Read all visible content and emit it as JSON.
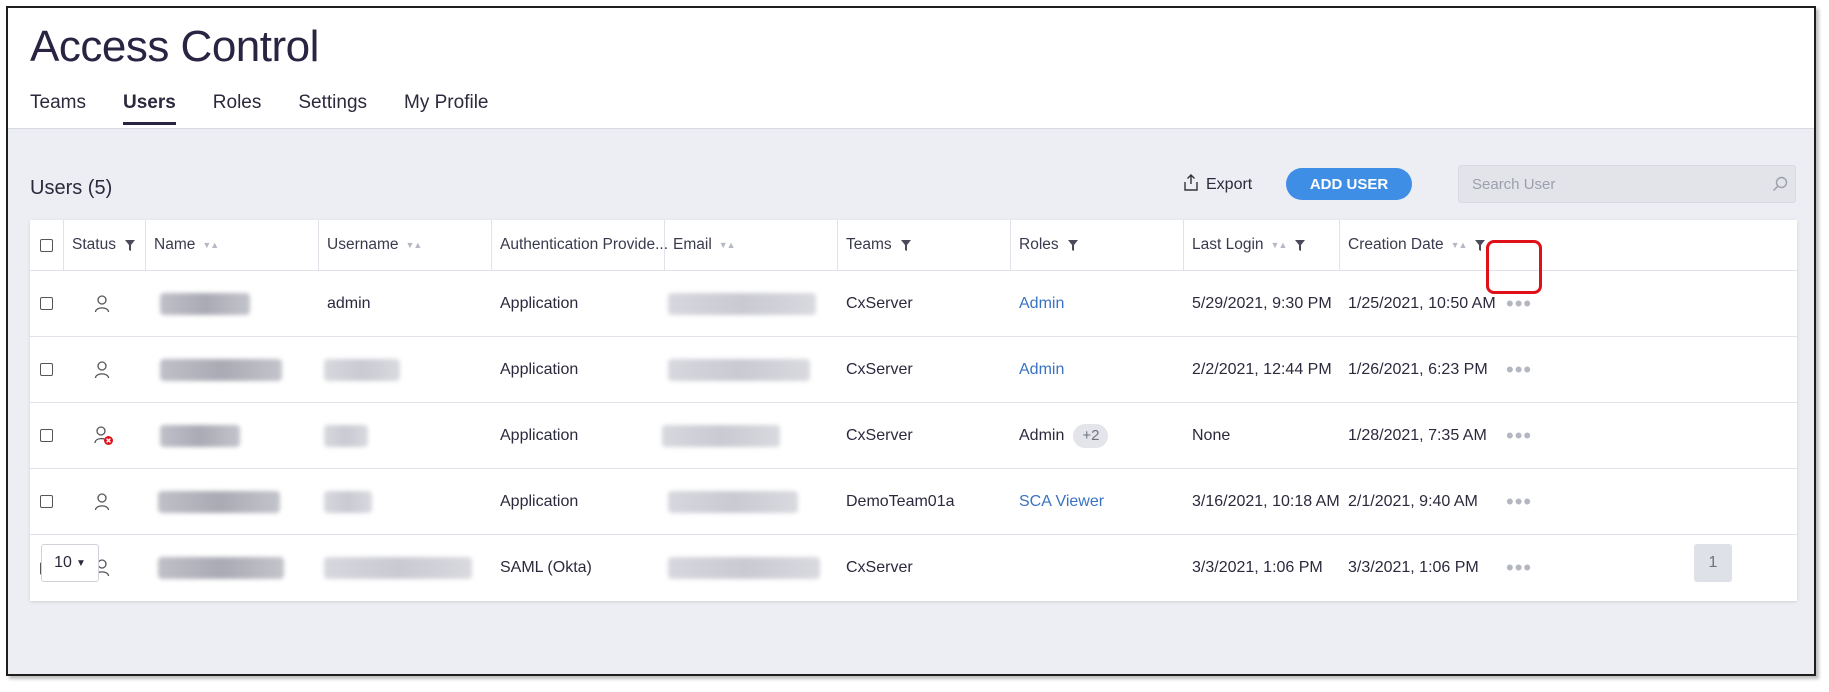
{
  "page": {
    "title": "Access Control"
  },
  "tabs": [
    {
      "label": "Teams",
      "active": false
    },
    {
      "label": "Users",
      "active": true
    },
    {
      "label": "Roles",
      "active": false
    },
    {
      "label": "Settings",
      "active": false
    },
    {
      "label": "My Profile",
      "active": false
    }
  ],
  "users_section": {
    "title": "Users (5)",
    "export_label": "Export",
    "add_user_label": "ADD USER",
    "search_placeholder": "Search User"
  },
  "table": {
    "columns": [
      {
        "label": "Status",
        "control": "filter"
      },
      {
        "label": "Name",
        "control": "sort"
      },
      {
        "label": "Username",
        "control": "sort"
      },
      {
        "label": "Authentication Provide...",
        "control": "none"
      },
      {
        "label": "Email",
        "control": "sort"
      },
      {
        "label": "Teams",
        "control": "filter"
      },
      {
        "label": "Roles",
        "control": "filter"
      },
      {
        "label": "Last Login",
        "control": "sort+filter"
      },
      {
        "label": "Creation Date",
        "control": "sort+filter"
      }
    ],
    "rows": [
      {
        "status": "active",
        "name": "",
        "username": "admin",
        "auth_provider": "Application",
        "email": "",
        "teams": "CxServer",
        "role": "Admin",
        "role_style": "link",
        "extra_roles": "",
        "last_login": "5/29/2021, 9:30 PM",
        "creation_date": "1/25/2021, 10:50 AM",
        "actions": "•••"
      },
      {
        "status": "active",
        "name": "",
        "username": "",
        "auth_provider": "Application",
        "email": "",
        "teams": "CxServer",
        "role": "Admin",
        "role_style": "link",
        "extra_roles": "",
        "last_login": "2/2/2021, 12:44 PM",
        "creation_date": "1/26/2021, 6:23 PM",
        "actions": "•••"
      },
      {
        "status": "disabled",
        "name": "",
        "username": "",
        "auth_provider": "Application",
        "email": "",
        "teams": "CxServer",
        "role": "Admin",
        "role_style": "plain",
        "extra_roles": "+2",
        "last_login": "None",
        "creation_date": "1/28/2021, 7:35 AM",
        "actions": "•••"
      },
      {
        "status": "active",
        "name": "",
        "username": "",
        "auth_provider": "Application",
        "email": "",
        "teams": "DemoTeam01a",
        "role": "SCA Viewer",
        "role_style": "link",
        "extra_roles": "",
        "last_login": "3/16/2021, 10:18 AM",
        "creation_date": "2/1/2021, 9:40 AM",
        "actions": "•••"
      },
      {
        "status": "active",
        "name": "",
        "username": "",
        "auth_provider": "SAML (Okta)",
        "email": "",
        "teams": "CxServer",
        "role": "",
        "role_style": "plain",
        "extra_roles": "",
        "last_login": "3/3/2021, 1:06 PM",
        "creation_date": "3/3/2021, 1:06 PM",
        "actions": "•••"
      }
    ]
  },
  "pagination": {
    "page_size": "10",
    "current_page": "1"
  },
  "colors": {
    "accent": "#3e8ee6",
    "title": "#2a2342",
    "link": "#3a73c2",
    "highlight": "#e0101b",
    "background": "#eceef4"
  }
}
